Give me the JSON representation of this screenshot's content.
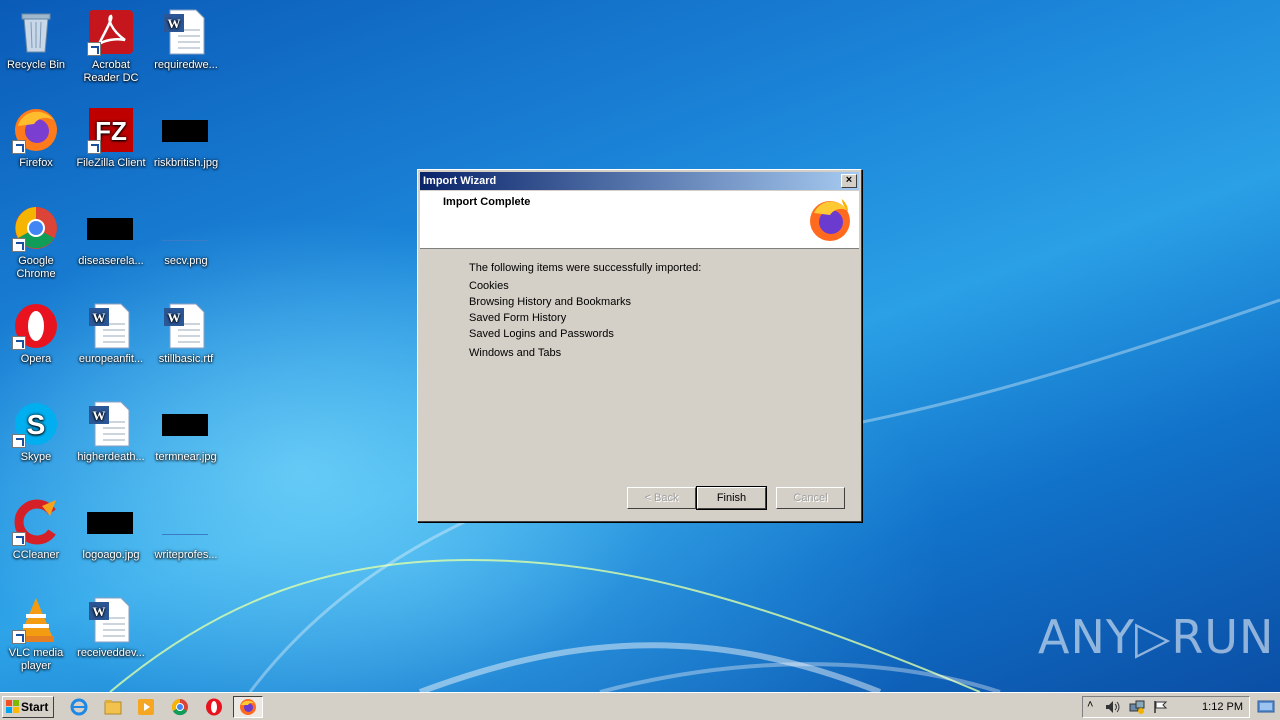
{
  "desktop": {
    "icons": [
      {
        "label": "Recycle Bin"
      },
      {
        "label": "Acrobat Reader DC"
      },
      {
        "label": "requiredwe..."
      },
      {
        "label": "Firefox"
      },
      {
        "label": "FileZilla Client"
      },
      {
        "label": "riskbritish.jpg"
      },
      {
        "label": "Google Chrome"
      },
      {
        "label": "diseaserela..."
      },
      {
        "label": "secv.png"
      },
      {
        "label": "Opera"
      },
      {
        "label": "europeanfit..."
      },
      {
        "label": "stillbasic.rtf"
      },
      {
        "label": "Skype"
      },
      {
        "label": "higherdeath..."
      },
      {
        "label": "termnear.jpg"
      },
      {
        "label": "CCleaner"
      },
      {
        "label": "logoago.jpg"
      },
      {
        "label": "writeprofes..."
      },
      {
        "label": "VLC media player"
      },
      {
        "label": "receiveddev..."
      }
    ],
    "watermark": "ANY▷RUN"
  },
  "dialog": {
    "title": "Import Wizard",
    "close_glyph": "×",
    "header_title": "Import Complete",
    "intro": "The following items were successfully imported:",
    "items": [
      "Cookies",
      "Browsing History and Bookmarks",
      "Saved Form History",
      "Saved Logins and Passwords",
      "Windows and Tabs"
    ],
    "buttons": {
      "back": "< Back",
      "finish": "Finish",
      "cancel": "Cancel"
    }
  },
  "taskbar": {
    "start_label": "Start",
    "clock": "1:12 PM"
  }
}
